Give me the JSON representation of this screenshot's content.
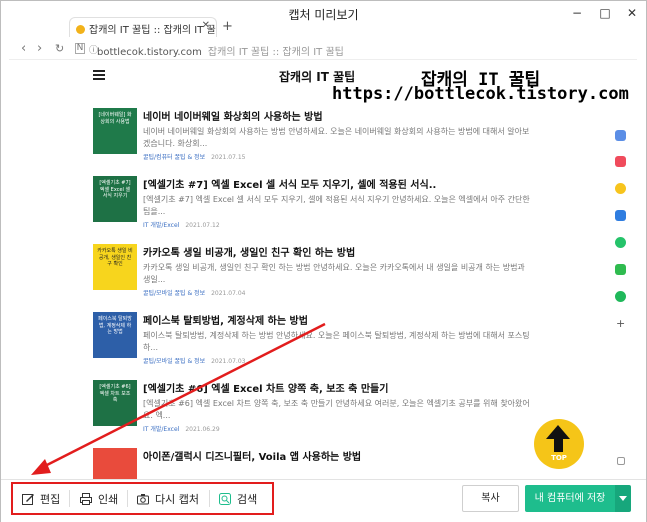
{
  "window": {
    "title": "캡처 미리보기",
    "controls": {
      "minimize": "−",
      "maximize": "□",
      "close": "✕"
    }
  },
  "browser": {
    "tab_title": "잡캐의 IT 꿀팁 :: 잡캐의 IT 꿀팁",
    "new_tab": "+",
    "tab_close": "✕",
    "url": "bottlecok.tistory.com",
    "url_page": "잡캐의 IT 꿀팁 :: 잡캐의 IT 꿀팁"
  },
  "page": {
    "blog_title": "잡캐의 IT 꿀팁",
    "overlay_title": "잡캐의 IT 꿀팁",
    "overlay_url": "https://bottlecok.tistory.com",
    "posts": [
      {
        "title": "네이버 네이버웨일 화상회의 사용하는 방법",
        "desc": "네이버 네이버웨일 화상회의 사용하는 방법 안녕하세요. 오늘은 네이버웨일 화상회의 사용하는 방법에 대해서 알아보겠습니다. 화상회...",
        "category": "꿀팁/컴퓨터 꿀팁 & 정보",
        "date": "2021.07.15",
        "thumb_text": "[네이버웨일] 화상회의 사용법",
        "thumb_color": "#1f7a4a"
      },
      {
        "title": "[엑셀기초 #7] 엑셀 Excel 셀 서식 모두 지우기, 셀에 적용된 서식..",
        "desc": "[엑셀기초 #7] 엑셀 Excel 셀 서식 모두 지우기, 셀에 적용된 서식 지우기 안녕하세요. 오늘은 엑셀에서 아주 간단한 팁을...",
        "category": "IT 개발/Excel",
        "date": "2021.07.12",
        "thumb_text": "[엑셀기초 #7] 엑셀 Excel 셀 서식 지우기",
        "thumb_color": "#1e7145"
      },
      {
        "title": "카카오톡 생일 비공개, 생일인 친구 확인 하는 방법",
        "desc": "카카오톡 생일 비공개, 생일인 친구 확인 하는 방법 안녕하세요. 오늘은 카카오톡에서 내 생일을 비공개 하는 방법과 생일...",
        "category": "꿀팁/모바일 꿀팁 & 정보",
        "date": "2021.07.04",
        "thumb_text": "카카오톡 생일 비공개, 생일인 친구 확인",
        "thumb_color": "#f7d51d"
      },
      {
        "title": "페이스북 탈퇴방법, 계정삭제 하는 방법",
        "desc": "페이스북 탈퇴방법, 계정삭제 하는 방법 안녕하세요. 오늘은 페이스북 탈퇴방법, 계정삭제 하는 방법에 대해서 포스팅하...",
        "category": "꿀팁/모바일 꿀팁 & 정보",
        "date": "2021.07.03",
        "thumb_text": "페이스북 탈퇴방법, 계정삭제 하는 방법",
        "thumb_color": "#2d5fa8"
      },
      {
        "title": "[엑셀기초 #6] 엑셀 Excel 차트 양쪽 축, 보조 축 만들기",
        "desc": "[엑셀기초 #6] 엑셀 Excel 차트 양쪽 축, 보조 축 만들기 안녕하세요 여러분, 오늘은 엑셀기초 공부를 위해 찾아왔어요. 엑...",
        "category": "IT 개발/Excel",
        "date": "2021.06.29",
        "thumb_text": "[엑셀기초 #6] 엑셀 차트 보조 축",
        "thumb_color": "#1e7145"
      },
      {
        "title": "아이폰/갤럭시 디즈니필터, Voila 앱 사용하는 방법",
        "desc": "",
        "category": "",
        "date": "",
        "thumb_text": "",
        "thumb_color": "#e94b3c"
      }
    ]
  },
  "top_button": {
    "label": "TOP"
  },
  "toolbar": {
    "edit_label": "편집",
    "print_label": "인쇄",
    "recapture_label": "다시 캡처",
    "search_label": "검색",
    "copy_label": "복사",
    "save_label": "내 컴퓨터에 저장"
  },
  "colors": {
    "accent_green": "#1ebd8d",
    "highlight_red": "#e21d1d",
    "top_button": "#f5c518"
  }
}
